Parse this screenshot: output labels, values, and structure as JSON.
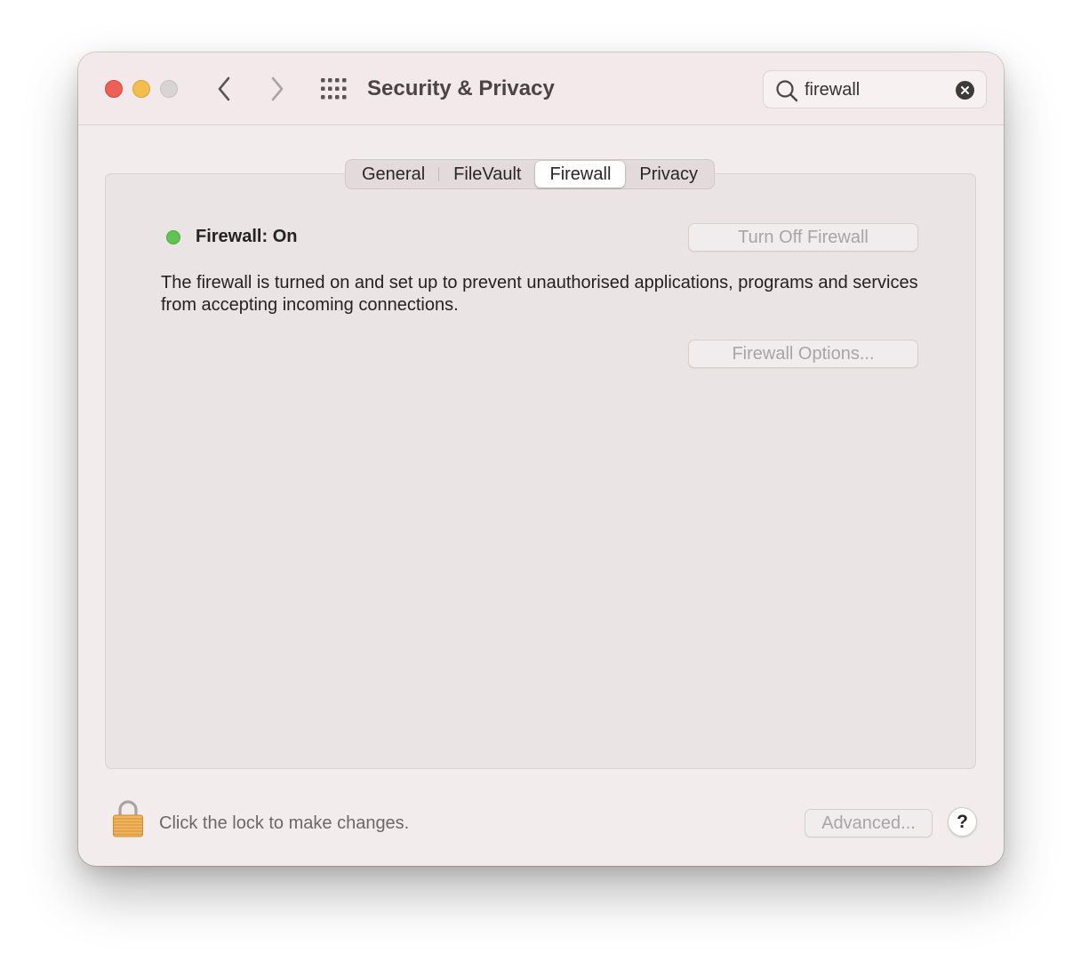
{
  "window": {
    "title": "Security & Privacy",
    "traffic_lights": [
      "close",
      "minimize",
      "zoom-disabled"
    ],
    "nav_icons": [
      "chevron-left-icon",
      "chevron-right-icon",
      "grid-icon"
    ]
  },
  "search": {
    "value": "firewall",
    "placeholder": "Search",
    "icon": "search-icon",
    "clear_icon": "clear-icon"
  },
  "tabs": [
    {
      "label": "General",
      "active": false
    },
    {
      "label": "FileVault",
      "active": false
    },
    {
      "label": "Firewall",
      "active": true
    },
    {
      "label": "Privacy",
      "active": false
    }
  ],
  "firewall": {
    "status_label": "Firewall: On",
    "status_color": "#5fc453",
    "turn_off_label": "Turn Off Firewall",
    "description": "The firewall is turned on and set up to prevent unauthorised applications, programs and services from accepting incoming connections.",
    "options_label": "Firewall Options..."
  },
  "footer": {
    "lock_icon": "lock-icon",
    "lock_text": "Click the lock to make changes.",
    "advanced_label": "Advanced...",
    "help_label": "?"
  },
  "colors": {
    "close": "#ed5f57",
    "minimize": "#f4bd4f",
    "zoom_disabled": "#dad3d4",
    "window_bg": "#f3ecec"
  }
}
